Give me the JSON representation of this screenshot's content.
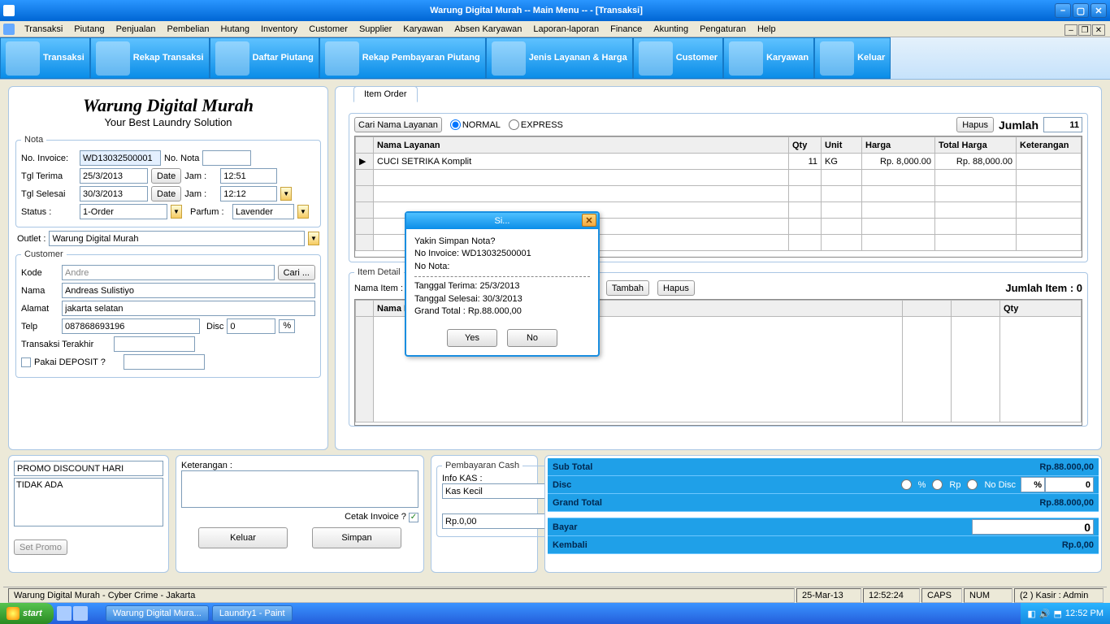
{
  "window": {
    "title": "Warung Digital Murah  -- Main Menu -- - [Transaksi]"
  },
  "menu": [
    "Transaksi",
    "Piutang",
    "Penjualan",
    "Pembelian",
    "Hutang",
    "Inventory",
    "Customer",
    "Supplier",
    "Karyawan",
    "Absen Karyawan",
    "Laporan-laporan",
    "Finance",
    "Akunting",
    "Pengaturan",
    "Help"
  ],
  "toolbar": [
    "Transaksi",
    "Rekap Transaksi",
    "Daftar Piutang",
    "Rekap Pembayaran Piutang",
    "Jenis Layanan & Harga",
    "Customer",
    "Karyawan",
    "Keluar"
  ],
  "company": {
    "name": "Warung Digital Murah",
    "tagline": "Your Best Laundry Solution"
  },
  "nota": {
    "legend": "Nota",
    "no_invoice_lbl": "No. Invoice:",
    "no_invoice": "WD13032500001",
    "no_nota_lbl": "No. Nota",
    "no_nota": "",
    "tgl_terima_lbl": "Tgl Terima",
    "tgl_terima": "25/3/2013",
    "tgl_selesai_lbl": "Tgl Selesai",
    "tgl_selesai": "30/3/2013",
    "date_btn": "Date",
    "jam_lbl": "Jam :",
    "jam_terima": "12:51",
    "jam_selesai": "12:12",
    "status_lbl": "Status :",
    "status": "1-Order",
    "parfum_lbl": "Parfum :",
    "parfum": "Lavender"
  },
  "outlet": {
    "lbl": "Outlet :",
    "val": "Warung Digital Murah"
  },
  "customer": {
    "legend": "Customer",
    "kode_lbl": "Kode",
    "kode": "Andre",
    "cari": "Cari ...",
    "nama_lbl": "Nama",
    "nama": "Andreas Sulistiyo",
    "alamat_lbl": "Alamat",
    "alamat": "jakarta selatan",
    "telp_lbl": "Telp",
    "telp": "087868693196",
    "disc_lbl": "Disc",
    "disc": "0",
    "pct": "%",
    "trans_terakhir_lbl": "Transaksi Terakhir",
    "deposit_lbl": "Pakai DEPOSIT ?"
  },
  "tab": {
    "item_order": "Item Order"
  },
  "svc": {
    "cari": "Cari Nama Layanan",
    "normal": "NORMAL",
    "express": "EXPRESS",
    "hapus": "Hapus",
    "jumlah_lbl": "Jumlah",
    "jumlah": "11",
    "headers": [
      "",
      "Nama Layanan",
      "Qty",
      "Unit",
      "Harga",
      "Total Harga",
      "Keterangan"
    ],
    "rows": [
      {
        "marker": "▶",
        "nama": "CUCI SETRIKA Komplit",
        "qty": "11",
        "unit": "KG",
        "harga": "Rp. 8,000.00",
        "total": "Rp. 88,000.00",
        "ket": ""
      }
    ]
  },
  "detail": {
    "legend": "Item Detail",
    "nama_item_lbl": "Nama Item :",
    "tambah": "Tambah",
    "hapus": "Hapus",
    "jumlah_lbl": "Jumlah Item : 0",
    "headers": [
      "",
      "Nama Ite",
      "",
      "",
      "Qty"
    ]
  },
  "promo": {
    "title": "PROMO DISCOUNT HARI",
    "body": "TIDAK ADA",
    "set": "Set Promo"
  },
  "keterangan": {
    "lbl": "Keterangan :",
    "cetak_lbl": "Cetak Invoice ?",
    "keluar": "Keluar",
    "simpan": "Simpan"
  },
  "cash": {
    "legend": "Pembayaran Cash",
    "info_lbl": "Info KAS :",
    "kas": "Kas Kecil",
    "rp": "Rp.0,00"
  },
  "totals": {
    "subtotal_lbl": "Sub Total",
    "subtotal": "Rp.88.000,00",
    "disc_lbl": "Disc",
    "r1": "%",
    "r2": "Rp",
    "r3": "No Disc",
    "disc_pct": "%",
    "disc_val": "0",
    "grand_lbl": "Grand Total",
    "grand": "Rp.88.000,00",
    "bayar_lbl": "Bayar",
    "bayar": "0",
    "kembali_lbl": "Kembali",
    "kembali": "Rp.0,00"
  },
  "dialog": {
    "title": "Si...",
    "l1": "Yakin Simpan Nota?",
    "l2": "No Invoice: WD13032500001",
    "l3": "No Nota:",
    "l4": "Tanggal Terima: 25/3/2013",
    "l5": "Tanggal Selesai: 30/3/2013",
    "l6": "Grand Total : Rp.88.000,00",
    "yes": "Yes",
    "no": "No"
  },
  "status": {
    "left": "Warung Digital Murah - Cyber Crime - Jakarta",
    "date": "25-Mar-13",
    "time": "12:52:24",
    "caps": "CAPS",
    "num": "NUM",
    "user": "(2 ) Kasir : Admin"
  },
  "taskbar": {
    "start": "start",
    "items": [
      "Warung Digital Mura...",
      "Laundry1 - Paint"
    ],
    "clock": "12:52 PM"
  }
}
